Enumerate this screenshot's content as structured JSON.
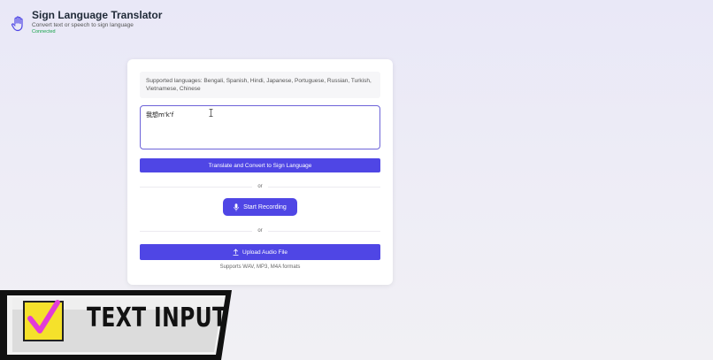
{
  "header": {
    "title": "Sign Language Translator",
    "subtitle": "Convert text or speech to sign language",
    "status": "Connected"
  },
  "card": {
    "languages_note": "Supported languages: Bengali, Spanish, Hindi, Japanese, Portuguese, Russian, Turkish, Vietnamese, Chinese",
    "text_input": {
      "value": "我想m'k'f",
      "placeholder": ""
    },
    "translate_label": "Translate and Convert to Sign Language",
    "or_1": "or",
    "record_label": "Start Recording",
    "or_2": "or",
    "upload_label": "Upload Audio File",
    "formats_note": "Supports WAV, MP3, M4A formats"
  },
  "banner": {
    "label": "TEXT INPUT"
  },
  "colors": {
    "accent": "#4f46e5",
    "connected": "#16a34a",
    "checkbox_fill": "#f5e12b",
    "checkmark": "#e23bd8"
  },
  "icons": [
    "hand-icon",
    "mic-icon",
    "upload-icon",
    "checkbox-check-icon",
    "text-cursor-icon"
  ]
}
